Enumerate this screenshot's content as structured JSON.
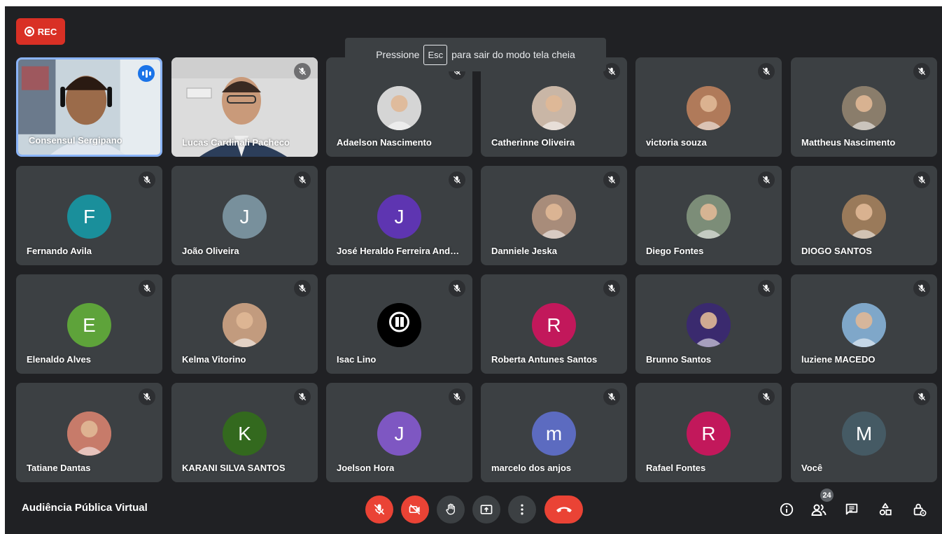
{
  "rec_label": "REC",
  "fullscreen_banner": {
    "prefix": "Pressione",
    "key": "Esc",
    "suffix": "para sair do modo tela cheia"
  },
  "meeting_title": "Audiência Pública Virtual",
  "participants_count": "24",
  "accent_color": "#8ab4f8",
  "danger_color": "#ea4335",
  "participants": [
    {
      "name": "Consensul Sergipano",
      "type": "video",
      "speaking": true
    },
    {
      "name": "Lucas Cardinali Pacheco",
      "type": "video2"
    },
    {
      "name": "Adaelson Nascimento",
      "type": "photo",
      "color": "#d5d5d5"
    },
    {
      "name": "Catherinne Oliveira",
      "type": "photo",
      "color": "#c9b6a6"
    },
    {
      "name": "victoria souza",
      "type": "photo",
      "color": "#b07a5a"
    },
    {
      "name": "Mattheus Nascimento",
      "type": "photo",
      "color": "#8a7d6b"
    },
    {
      "name": "Fernando Avila",
      "type": "letter",
      "letter": "F",
      "color": "#1a8f9b"
    },
    {
      "name": "João Oliveira",
      "type": "letter",
      "letter": "J",
      "color": "#78909c"
    },
    {
      "name": "José Heraldo Ferreira Andrade",
      "type": "letter",
      "letter": "J",
      "color": "#5e35b1"
    },
    {
      "name": "Danniele Jeska",
      "type": "photo",
      "color": "#a88c7a"
    },
    {
      "name": "Diego Fontes",
      "type": "photo",
      "color": "#7c8d78"
    },
    {
      "name": "DIOGO SANTOS",
      "type": "photo",
      "color": "#9a7a5a"
    },
    {
      "name": "Elenaldo Alves",
      "type": "letter",
      "letter": "E",
      "color": "#5ea33a"
    },
    {
      "name": "Kelma Vitorino",
      "type": "photo",
      "color": "#c29b7e"
    },
    {
      "name": "Isac Lino",
      "type": "logo",
      "color": "#000000"
    },
    {
      "name": "Roberta Antunes Santos",
      "type": "letter",
      "letter": "R",
      "color": "#c2185b"
    },
    {
      "name": "Brunno Santos",
      "type": "photo",
      "color": "#3a2a6e"
    },
    {
      "name": "luziene MACEDO",
      "type": "photo",
      "color": "#7fa7c9"
    },
    {
      "name": "Tatiane Dantas",
      "type": "photo",
      "color": "#c77b6a"
    },
    {
      "name": "KARANI SILVA SANTOS",
      "type": "letter",
      "letter": "K",
      "color": "#33691e"
    },
    {
      "name": "Joelson Hora",
      "type": "letter",
      "letter": "J",
      "color": "#7e57c2"
    },
    {
      "name": "marcelo dos anjos",
      "type": "letter",
      "letter": "m",
      "color": "#5c6bc0"
    },
    {
      "name": "Rafael Fontes",
      "type": "letter",
      "letter": "R",
      "color": "#c2185b"
    },
    {
      "name": "Você",
      "type": "letter",
      "letter": "M",
      "color": "#455a64"
    }
  ],
  "controls": [
    {
      "id": "mic",
      "icon": "mic-off-icon"
    },
    {
      "id": "camera",
      "icon": "camera-off-icon"
    },
    {
      "id": "hand",
      "icon": "raise-hand-icon"
    },
    {
      "id": "present",
      "icon": "present-screen-icon"
    },
    {
      "id": "more",
      "icon": "more-options-icon"
    },
    {
      "id": "leave",
      "icon": "end-call-icon"
    }
  ],
  "right_icons": [
    "info-icon",
    "people-icon",
    "chat-icon",
    "activities-icon",
    "host-controls-icon"
  ]
}
